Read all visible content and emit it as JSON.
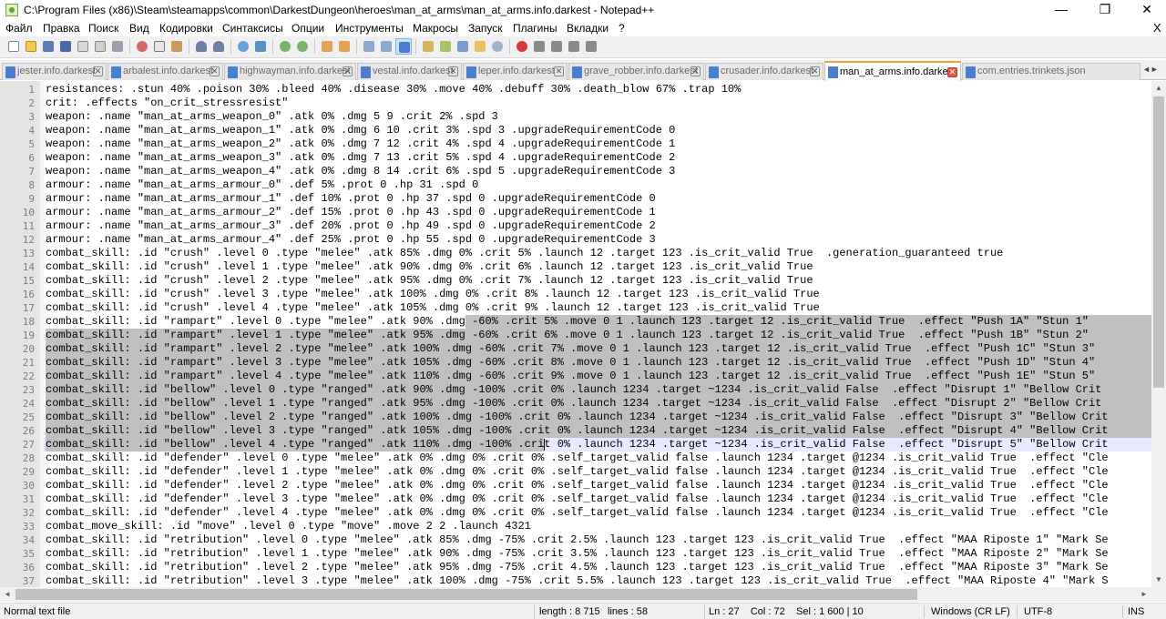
{
  "window": {
    "title": "C:\\Program Files (x86)\\Steam\\steamapps\\common\\DarkestDungeon\\heroes\\man_at_arms\\man_at_arms.info.darkest - Notepad++",
    "minimize": "—",
    "maximize": "❐",
    "close": "✕"
  },
  "menu": {
    "items": [
      "Файл",
      "Правка",
      "Поиск",
      "Вид",
      "Кодировки",
      "Синтаксисы",
      "Опции",
      "Инструменты",
      "Макросы",
      "Запуск",
      "Плагины",
      "Вкладки",
      "?"
    ],
    "close_doc": "X"
  },
  "toolbar": {
    "buttons": [
      "new",
      "open",
      "save",
      "save-all",
      "close",
      "close-all",
      "print",
      "cut",
      "copy",
      "paste",
      "undo",
      "redo",
      "find",
      "replace",
      "zoom-in",
      "zoom-out",
      "sync-vertical",
      "sync-horizontal",
      "word-wrap",
      "show-all-chars",
      "indent-guide",
      "user-lang",
      "doc-map",
      "function-list",
      "folder-workspace",
      "monitoring",
      "record-macro",
      "stop-macro",
      "play-macro",
      "run-macro-multiple",
      "save-macro"
    ]
  },
  "tabs": [
    {
      "label": "jester.info.darkest",
      "active": false
    },
    {
      "label": "arbalest.info.darkest",
      "active": false
    },
    {
      "label": "highwayman.info.darkest",
      "active": false
    },
    {
      "label": "vestal.info.darkest",
      "active": false
    },
    {
      "label": "leper.info.darkest",
      "active": false
    },
    {
      "label": "grave_robber.info.darkest",
      "active": false
    },
    {
      "label": "crusader.info.darkest",
      "active": false
    },
    {
      "label": "man_at_arms.info.darkest",
      "active": true
    },
    {
      "label": "com.entries.trinkets.json",
      "active": false
    }
  ],
  "tab_scroll": "◄►",
  "editor": {
    "lines": [
      {
        "n": "1",
        "text": "resistances: .stun 40% .poison 30% .bleed 40% .disease 30% .move 40% .debuff 30% .death_blow 67% .trap 10%"
      },
      {
        "n": "2",
        "text": "crit: .effects \"on_crit_stressresist\""
      },
      {
        "n": "3",
        "text": "weapon: .name \"man_at_arms_weapon_0\" .atk 0% .dmg 5 9 .crit 2% .spd 3"
      },
      {
        "n": "4",
        "text": "weapon: .name \"man_at_arms_weapon_1\" .atk 0% .dmg 6 10 .crit 3% .spd 3 .upgradeRequirementCode 0"
      },
      {
        "n": "5",
        "text": "weapon: .name \"man_at_arms_weapon_2\" .atk 0% .dmg 7 12 .crit 4% .spd 4 .upgradeRequirementCode 1"
      },
      {
        "n": "6",
        "text": "weapon: .name \"man_at_arms_weapon_3\" .atk 0% .dmg 7 13 .crit 5% .spd 4 .upgradeRequirementCode 2"
      },
      {
        "n": "7",
        "text": "weapon: .name \"man_at_arms_weapon_4\" .atk 0% .dmg 8 14 .crit 6% .spd 5 .upgradeRequirementCode 3"
      },
      {
        "n": "8",
        "text": "armour: .name \"man_at_arms_armour_0\" .def 5% .prot 0 .hp 31 .spd 0"
      },
      {
        "n": "9",
        "text": "armour: .name \"man_at_arms_armour_1\" .def 10% .prot 0 .hp 37 .spd 0 .upgradeRequirementCode 0"
      },
      {
        "n": "10",
        "text": "armour: .name \"man_at_arms_armour_2\" .def 15% .prot 0 .hp 43 .spd 0 .upgradeRequirementCode 1"
      },
      {
        "n": "11",
        "text": "armour: .name \"man_at_arms_armour_3\" .def 20% .prot 0 .hp 49 .spd 0 .upgradeRequirementCode 2"
      },
      {
        "n": "12",
        "text": "armour: .name \"man_at_arms_armour_4\" .def 25% .prot 0 .hp 55 .spd 0 .upgradeRequirementCode 3"
      },
      {
        "n": "13",
        "text": "combat_skill: .id \"crush\" .level 0 .type \"melee\" .atk 85% .dmg 0% .crit 5% .launch 12 .target 123 .is_crit_valid True  .generation_guaranteed true"
      },
      {
        "n": "14",
        "text": "combat_skill: .id \"crush\" .level 1 .type \"melee\" .atk 90% .dmg 0% .crit 6% .launch 12 .target 123 .is_crit_valid True"
      },
      {
        "n": "15",
        "text": "combat_skill: .id \"crush\" .level 2 .type \"melee\" .atk 95% .dmg 0% .crit 7% .launch 12 .target 123 .is_crit_valid True"
      },
      {
        "n": "16",
        "text": "combat_skill: .id \"crush\" .level 3 .type \"melee\" .atk 100% .dmg 0% .crit 8% .launch 12 .target 123 .is_crit_valid True"
      },
      {
        "n": "17",
        "text": "combat_skill: .id \"crush\" .level 4 .type \"melee\" .atk 105% .dmg 0% .crit 9% .launch 12 .target 123 .is_crit_valid True"
      },
      {
        "n": "18",
        "text": "combat_skill: .id \"rampart\" .level 0 .type \"melee\" .atk 90% .dmg -60% .crit 5% .move 0 1 .launch 123 .target 12 .is_crit_valid True  .effect \"Push 1A\" \"Stun 1\""
      },
      {
        "n": "19",
        "text": "combat_skill: .id \"rampart\" .level 1 .type \"melee\" .atk 95% .dmg -60% .crit 6% .move 0 1 .launch 123 .target 12 .is_crit_valid True  .effect \"Push 1B\" \"Stun 2\""
      },
      {
        "n": "20",
        "text": "combat_skill: .id \"rampart\" .level 2 .type \"melee\" .atk 100% .dmg -60% .crit 7% .move 0 1 .launch 123 .target 12 .is_crit_valid True  .effect \"Push 1C\" \"Stun 3\""
      },
      {
        "n": "21",
        "text": "combat_skill: .id \"rampart\" .level 3 .type \"melee\" .atk 105% .dmg -60% .crit 8% .move 0 1 .launch 123 .target 12 .is_crit_valid True  .effect \"Push 1D\" \"Stun 4\""
      },
      {
        "n": "22",
        "text": "combat_skill: .id \"rampart\" .level 4 .type \"melee\" .atk 110% .dmg -60% .crit 9% .move 0 1 .launch 123 .target 12 .is_crit_valid True  .effect \"Push 1E\" \"Stun 5\""
      },
      {
        "n": "23",
        "text": "combat_skill: .id \"bellow\" .level 0 .type \"ranged\" .atk 90% .dmg -100% .crit 0% .launch 1234 .target ~1234 .is_crit_valid False  .effect \"Disrupt 1\" \"Bellow Crit"
      },
      {
        "n": "24",
        "text": "combat_skill: .id \"bellow\" .level 1 .type \"ranged\" .atk 95% .dmg -100% .crit 0% .launch 1234 .target ~1234 .is_crit_valid False  .effect \"Disrupt 2\" \"Bellow Crit"
      },
      {
        "n": "25",
        "text": "combat_skill: .id \"bellow\" .level 2 .type \"ranged\" .atk 100% .dmg -100% .crit 0% .launch 1234 .target ~1234 .is_crit_valid False  .effect \"Disrupt 3\" \"Bellow Crit"
      },
      {
        "n": "26",
        "text": "combat_skill: .id \"bellow\" .level 3 .type \"ranged\" .atk 105% .dmg -100% .crit 0% .launch 1234 .target ~1234 .is_crit_valid False  .effect \"Disrupt 4\" \"Bellow Crit"
      },
      {
        "n": "27",
        "text": "combat_skill: .id \"bellow\" .level 4 .type \"ranged\" .atk 110% .dmg -100% .crit 0% .launch 1234 .target ~1234 .is_crit_valid False  .effect \"Disrupt 5\" \"Bellow Crit"
      },
      {
        "n": "28",
        "text": "combat_skill: .id \"defender\" .level 0 .type \"melee\" .atk 0% .dmg 0% .crit 0% .self_target_valid false .launch 1234 .target @1234 .is_crit_valid True  .effect \"Cle"
      },
      {
        "n": "29",
        "text": "combat_skill: .id \"defender\" .level 1 .type \"melee\" .atk 0% .dmg 0% .crit 0% .self_target_valid false .launch 1234 .target @1234 .is_crit_valid True  .effect \"Cle"
      },
      {
        "n": "30",
        "text": "combat_skill: .id \"defender\" .level 2 .type \"melee\" .atk 0% .dmg 0% .crit 0% .self_target_valid false .launch 1234 .target @1234 .is_crit_valid True  .effect \"Cle"
      },
      {
        "n": "31",
        "text": "combat_skill: .id \"defender\" .level 3 .type \"melee\" .atk 0% .dmg 0% .crit 0% .self_target_valid false .launch 1234 .target @1234 .is_crit_valid True  .effect \"Cle"
      },
      {
        "n": "32",
        "text": "combat_skill: .id \"defender\" .level 4 .type \"melee\" .atk 0% .dmg 0% .crit 0% .self_target_valid false .launch 1234 .target @1234 .is_crit_valid True  .effect \"Cle"
      },
      {
        "n": "33",
        "text": "combat_move_skill: .id \"move\" .level 0 .type \"move\" .move 2 2 .launch 4321"
      },
      {
        "n": "34",
        "text": "combat_skill: .id \"retribution\" .level 0 .type \"melee\" .atk 85% .dmg -75% .crit 2.5% .launch 123 .target 123 .is_crit_valid True  .effect \"MAA Riposte 1\" \"Mark Se"
      },
      {
        "n": "35",
        "text": "combat_skill: .id \"retribution\" .level 1 .type \"melee\" .atk 90% .dmg -75% .crit 3.5% .launch 123 .target 123 .is_crit_valid True  .effect \"MAA Riposte 2\" \"Mark Se"
      },
      {
        "n": "36",
        "text": "combat_skill: .id \"retribution\" .level 2 .type \"melee\" .atk 95% .dmg -75% .crit 4.5% .launch 123 .target 123 .is_crit_valid True  .effect \"MAA Riposte 3\" \"Mark Se"
      },
      {
        "n": "37",
        "text": "combat_skill: .id \"retribution\" .level 3 .type \"melee\" .atk 100% .dmg -75% .crit 5.5% .launch 123 .target 123 .is_crit_valid True  .effect \"MAA Riposte 4\" \"Mark S"
      }
    ]
  },
  "scroll": {
    "up": "▲",
    "down": "▼",
    "left": "◄",
    "right": "►"
  },
  "status": {
    "file_type": "Normal text file",
    "length": "length : 8 715",
    "lines": "lines : 58",
    "position": "Ln : 27    Col : 72    Sel : 1 600 | 10",
    "eol": "Windows (CR LF)",
    "encoding": "UTF-8",
    "mode": "INS"
  },
  "colors": {
    "selection": "#c0c0c0",
    "caret_line": "#e8e8ff",
    "active_tab_accent": "#f2a23c"
  }
}
